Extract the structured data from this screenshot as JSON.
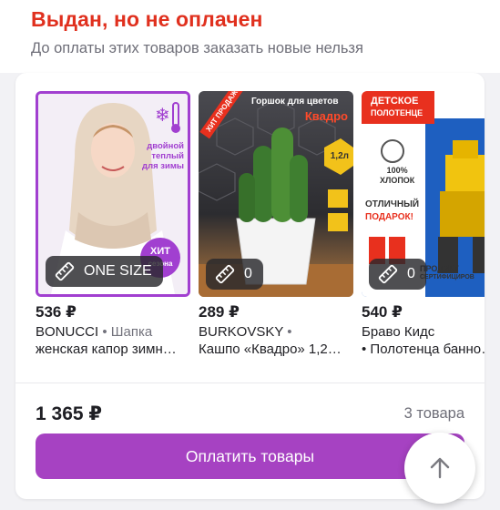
{
  "header": {
    "title": "Выдан, но не оплачен",
    "subtitle": "До оплаты этих товаров заказать новые нельзя"
  },
  "products": [
    {
      "price": "536 ₽",
      "brand": "BONUCCI",
      "sep": " • ",
      "desc_line1": "Шапка",
      "desc_line2": "женская капор зимн…",
      "badge": "ONE SIZE",
      "art_text": [
        "двойной",
        "теплый",
        "для зимы"
      ],
      "art_sticker": [
        "ХИТ",
        "сезона"
      ]
    },
    {
      "price": "289 ₽",
      "brand": "BURKOVSKY",
      "sep": " •",
      "desc_line2": "Кашпо «Квадро» 1,2…",
      "badge": "0",
      "art_text": [
        "Горшок для цветов",
        "Квадро"
      ],
      "art_sticker": [
        "ХИТ ПРОДАЖ!"
      ],
      "art_size": "1,2л"
    },
    {
      "price": "540 ₽",
      "brand": "Браво Кидс",
      "desc_line2": "• Полотенца банно…",
      "badge": "0",
      "art_text": [
        "ДЕТСКОЕ",
        "ПОЛОТЕНЦЕ"
      ],
      "art_features": [
        "100%",
        "ХЛОПОК",
        "ОТЛИЧНЫЙ",
        "ПОДАРОК!",
        "ПРОДУКТ",
        "СЕРТИФИЦИРОВ"
      ]
    }
  ],
  "summary": {
    "total": "1 365 ₽",
    "count": "3 товара"
  },
  "pay_button": {
    "label": "Оплатить товары"
  },
  "colors": {
    "status_red": "#e0301e",
    "accent_purple": "#a642c2",
    "muted": "#6e6e78"
  },
  "icons": [
    "ruler-icon",
    "arrow-up-icon"
  ]
}
